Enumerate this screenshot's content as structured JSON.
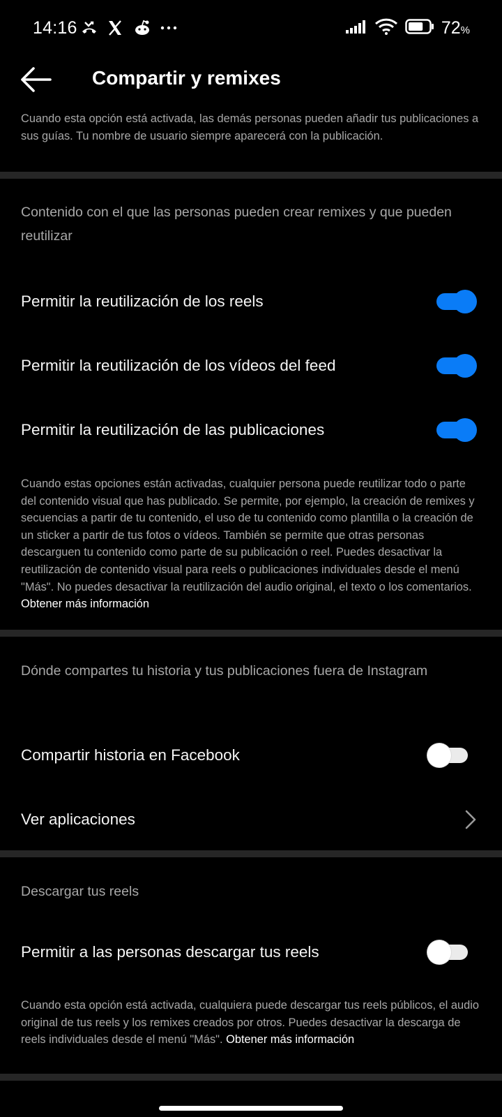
{
  "status_bar": {
    "time": "14:16",
    "left_icons": [
      "missed-call-icon",
      "x-logo-icon",
      "reddit-icon",
      "more-dots-icon"
    ],
    "battery_percent": "72",
    "battery_unit": "%",
    "battery_level": 0.72
  },
  "header": {
    "title": "Compartir y remixes"
  },
  "top_note": "Cuando esta opción está activada, las demás personas pueden añadir tus publicaciones a sus guías. Tu nombre de usuario siempre aparecerá con la publicación.",
  "remix_section": {
    "heading": "Contenido con el que las personas pueden crear remixes y que pueden reutilizar",
    "items": [
      {
        "label": "Permitir la reutilización de los reels",
        "enabled": true
      },
      {
        "label": "Permitir la reutilización de los vídeos del feed",
        "enabled": true
      },
      {
        "label": "Permitir la reutilización de las publicaciones",
        "enabled": true
      }
    ],
    "note": "Cuando estas opciones están activadas, cualquier persona puede reutilizar todo o parte del contenido visual que has publicado. Se permite, por ejemplo, la creación de remixes y secuencias a partir de tu contenido, el uso de tu contenido como plantilla o la creación de un sticker a partir de tus fotos o vídeos. También se permite que otras personas descarguen tu contenido como parte de su publicación o reel. Puedes desactivar la reutilización de contenido visual para reels o publicaciones individuales desde el menú \"Más\". No puedes desactivar la reutilización del audio original, el texto o los comentarios.",
    "note_link": "Obtener más información"
  },
  "share_section": {
    "heading": "Dónde compartes tu historia y tus publicaciones fuera de Instagram",
    "facebook_label": "Compartir historia en Facebook",
    "facebook_enabled": false,
    "apps_label": "Ver aplicaciones"
  },
  "download_section": {
    "heading": "Descargar tus reels",
    "item_label": "Permitir a las personas descargar tus reels",
    "item_enabled": false,
    "note": "Cuando esta opción está activada, cualquiera puede descargar tus reels públicos, el audio original de tus reels y los remixes creados por otros. Puedes desactivar la descarga de reels individuales desde el menú \"Más\".",
    "note_link": "Obtener más información"
  },
  "colors": {
    "background": "#000000",
    "toggle_on": "#0a7cf7",
    "divider": "#262626",
    "secondary_text": "#a8a8a8"
  }
}
